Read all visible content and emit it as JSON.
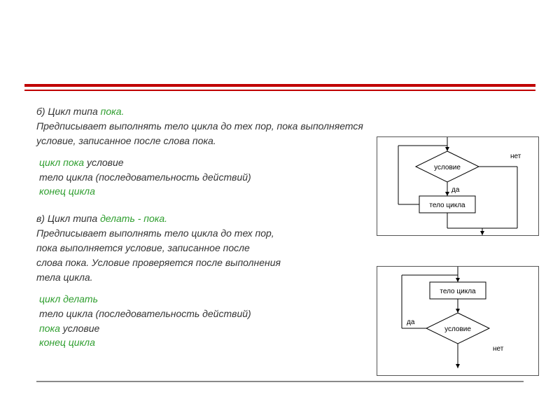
{
  "section_b": {
    "prefix": "б) Цикл типа ",
    "keyword": "пока.",
    "desc_l1": "Предписывает выполнять тело цикла до тех пор, пока выполняется",
    "desc_l2": "условие, записанное после слова пока.",
    "code": {
      "l1_kw": "цикл пока",
      "l1_rest": " условие",
      "l2": "тело цикла (последовательность действий)",
      "l3_kw": "конец цикла"
    }
  },
  "section_v": {
    "prefix": "в) Цикл типа ",
    "keyword": "делать - пока.",
    "desc_l1": "Предписывает выполнять тело цикла до тех пор,",
    "desc_l2": "пока выполняется условие, записанное после",
    "desc_l3": "слова пока. Условие проверяется после выполнения",
    "desc_l4": "тела цикла.",
    "code": {
      "l1_kw": "цикл делать",
      "l2": "тело цикла (последовательность действий)",
      "l3_kw": "пока",
      "l3_rest": " условие",
      "l4_kw": "конец цикла"
    }
  },
  "flow": {
    "cond": "условие",
    "body": "тело цикла",
    "yes": "да",
    "no": "нет"
  }
}
